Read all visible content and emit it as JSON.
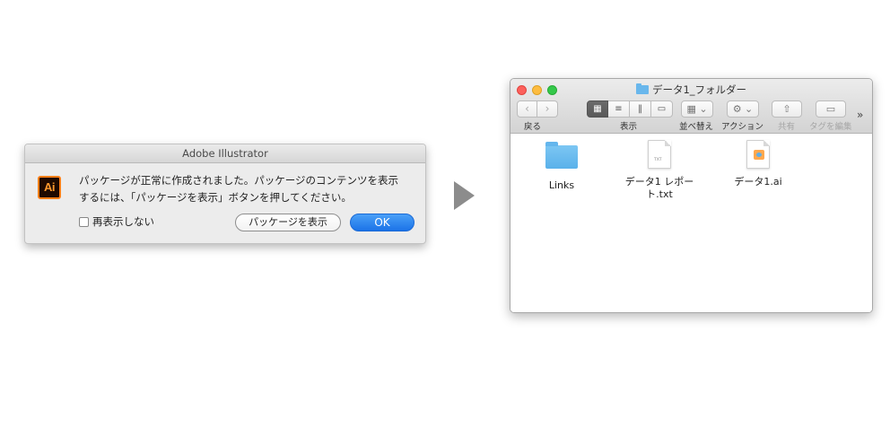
{
  "dialog": {
    "title": "Adobe Illustrator",
    "app_icon": "Ai",
    "message_line1": "パッケージが正常に作成されました。パッケージのコンテンツを表示",
    "message_line2": "するには、「パッケージを表示」ボタンを押してください。",
    "checkbox_label": "再表示しない",
    "checkbox_checked": false,
    "show_package_button": "パッケージを表示",
    "ok_button": "OK",
    "ok_color": "#1b73e8"
  },
  "finder": {
    "title": "データ1_フォルダー",
    "toolbar": {
      "back_label": "戻る",
      "view_label": "表示",
      "arrange_label": "並べ替え",
      "action_label": "アクション",
      "share_label": "共有",
      "tags_label": "タグを編集",
      "overflow": "»"
    },
    "files": [
      {
        "name": "Links",
        "icon": "folder-icon"
      },
      {
        "name_line1": "データ1 レポー",
        "name_line2": "ト.txt",
        "icon": "text-document-icon"
      },
      {
        "name": "データ1.ai",
        "icon": "illustrator-document-icon"
      }
    ],
    "traffic_colors": {
      "close": "#fc605c",
      "minimize": "#fdbc40",
      "zoom": "#34c84a"
    }
  }
}
